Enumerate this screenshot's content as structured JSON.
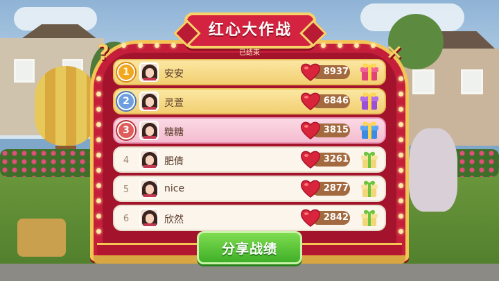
{
  "dialog": {
    "title": "红心大作战",
    "status": "已结束",
    "help_label": "?",
    "close_label": "✕",
    "share_label": "分享战绩"
  },
  "leaderboard": [
    {
      "rank": "1",
      "name": "安安",
      "score": "8937",
      "style": "gold",
      "gift": "big"
    },
    {
      "rank": "2",
      "name": "灵萱",
      "score": "6846",
      "style": "gold",
      "gift": "big"
    },
    {
      "rank": "3",
      "name": "糖糖",
      "score": "3815",
      "style": "pink",
      "gift": "big"
    },
    {
      "rank": "4",
      "name": "肥倩",
      "score": "3261",
      "style": "plain",
      "gift": "small"
    },
    {
      "rank": "5",
      "name": "nice",
      "score": "2877",
      "style": "plain",
      "gift": "small"
    },
    {
      "rank": "6",
      "name": "欣然",
      "score": "2842",
      "style": "plain",
      "gift": "small"
    }
  ],
  "icons": {
    "heart": "heart-icon",
    "gift": "gift-box-icon"
  },
  "colors": {
    "frame_red": "#c41e3a",
    "gold_trim": "#f4c455",
    "share_green": "#3faf28"
  }
}
